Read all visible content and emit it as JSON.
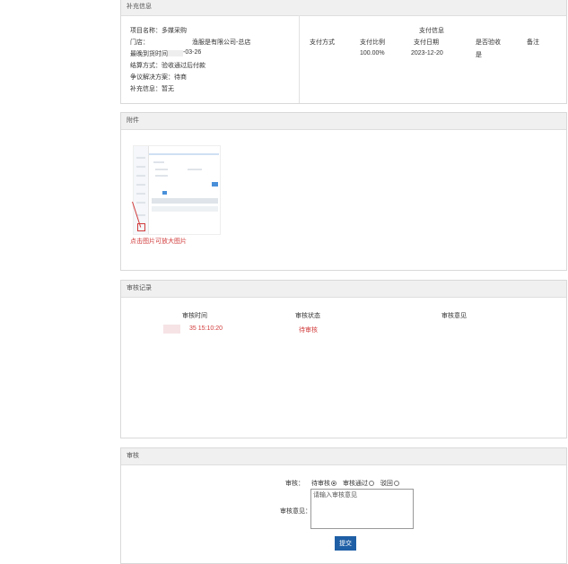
{
  "supplement": {
    "header": "补充信息",
    "project_name": "项目名称：多媒采购",
    "store_label": "门店：",
    "store_value": "渔服是有限公司-总店",
    "deadline_label": "最晚到货时间：",
    "deadline_value": "-03-26",
    "settlement": "结算方式：验收通过后付款",
    "dispute": "争议解决方案：待商",
    "extra": "补充信息：暂无"
  },
  "payment": {
    "title": "支付信息",
    "columns": [
      "支付方式",
      "支付比例",
      "支付日期",
      "是否验收",
      "备注"
    ],
    "row": [
      "",
      "100.00%",
      "2023-12-20",
      "是",
      ""
    ]
  },
  "attachment": {
    "header": "附件",
    "hint": "点击图片可放大图片"
  },
  "audit_records": {
    "header": "审核记录",
    "columns": [
      "审核时间",
      "审核状态",
      "审核意见"
    ],
    "row": {
      "time": "35 15:10:20",
      "status": "待审核",
      "opinion": ""
    }
  },
  "audit": {
    "header": "审核",
    "audit_label": "审核：",
    "options": [
      "待审核",
      "审核通过",
      "驳回"
    ],
    "selected": "待审核",
    "opinion_label": "审核意见：",
    "opinion_placeholder": "请输入审核意见",
    "submit": "提交"
  }
}
